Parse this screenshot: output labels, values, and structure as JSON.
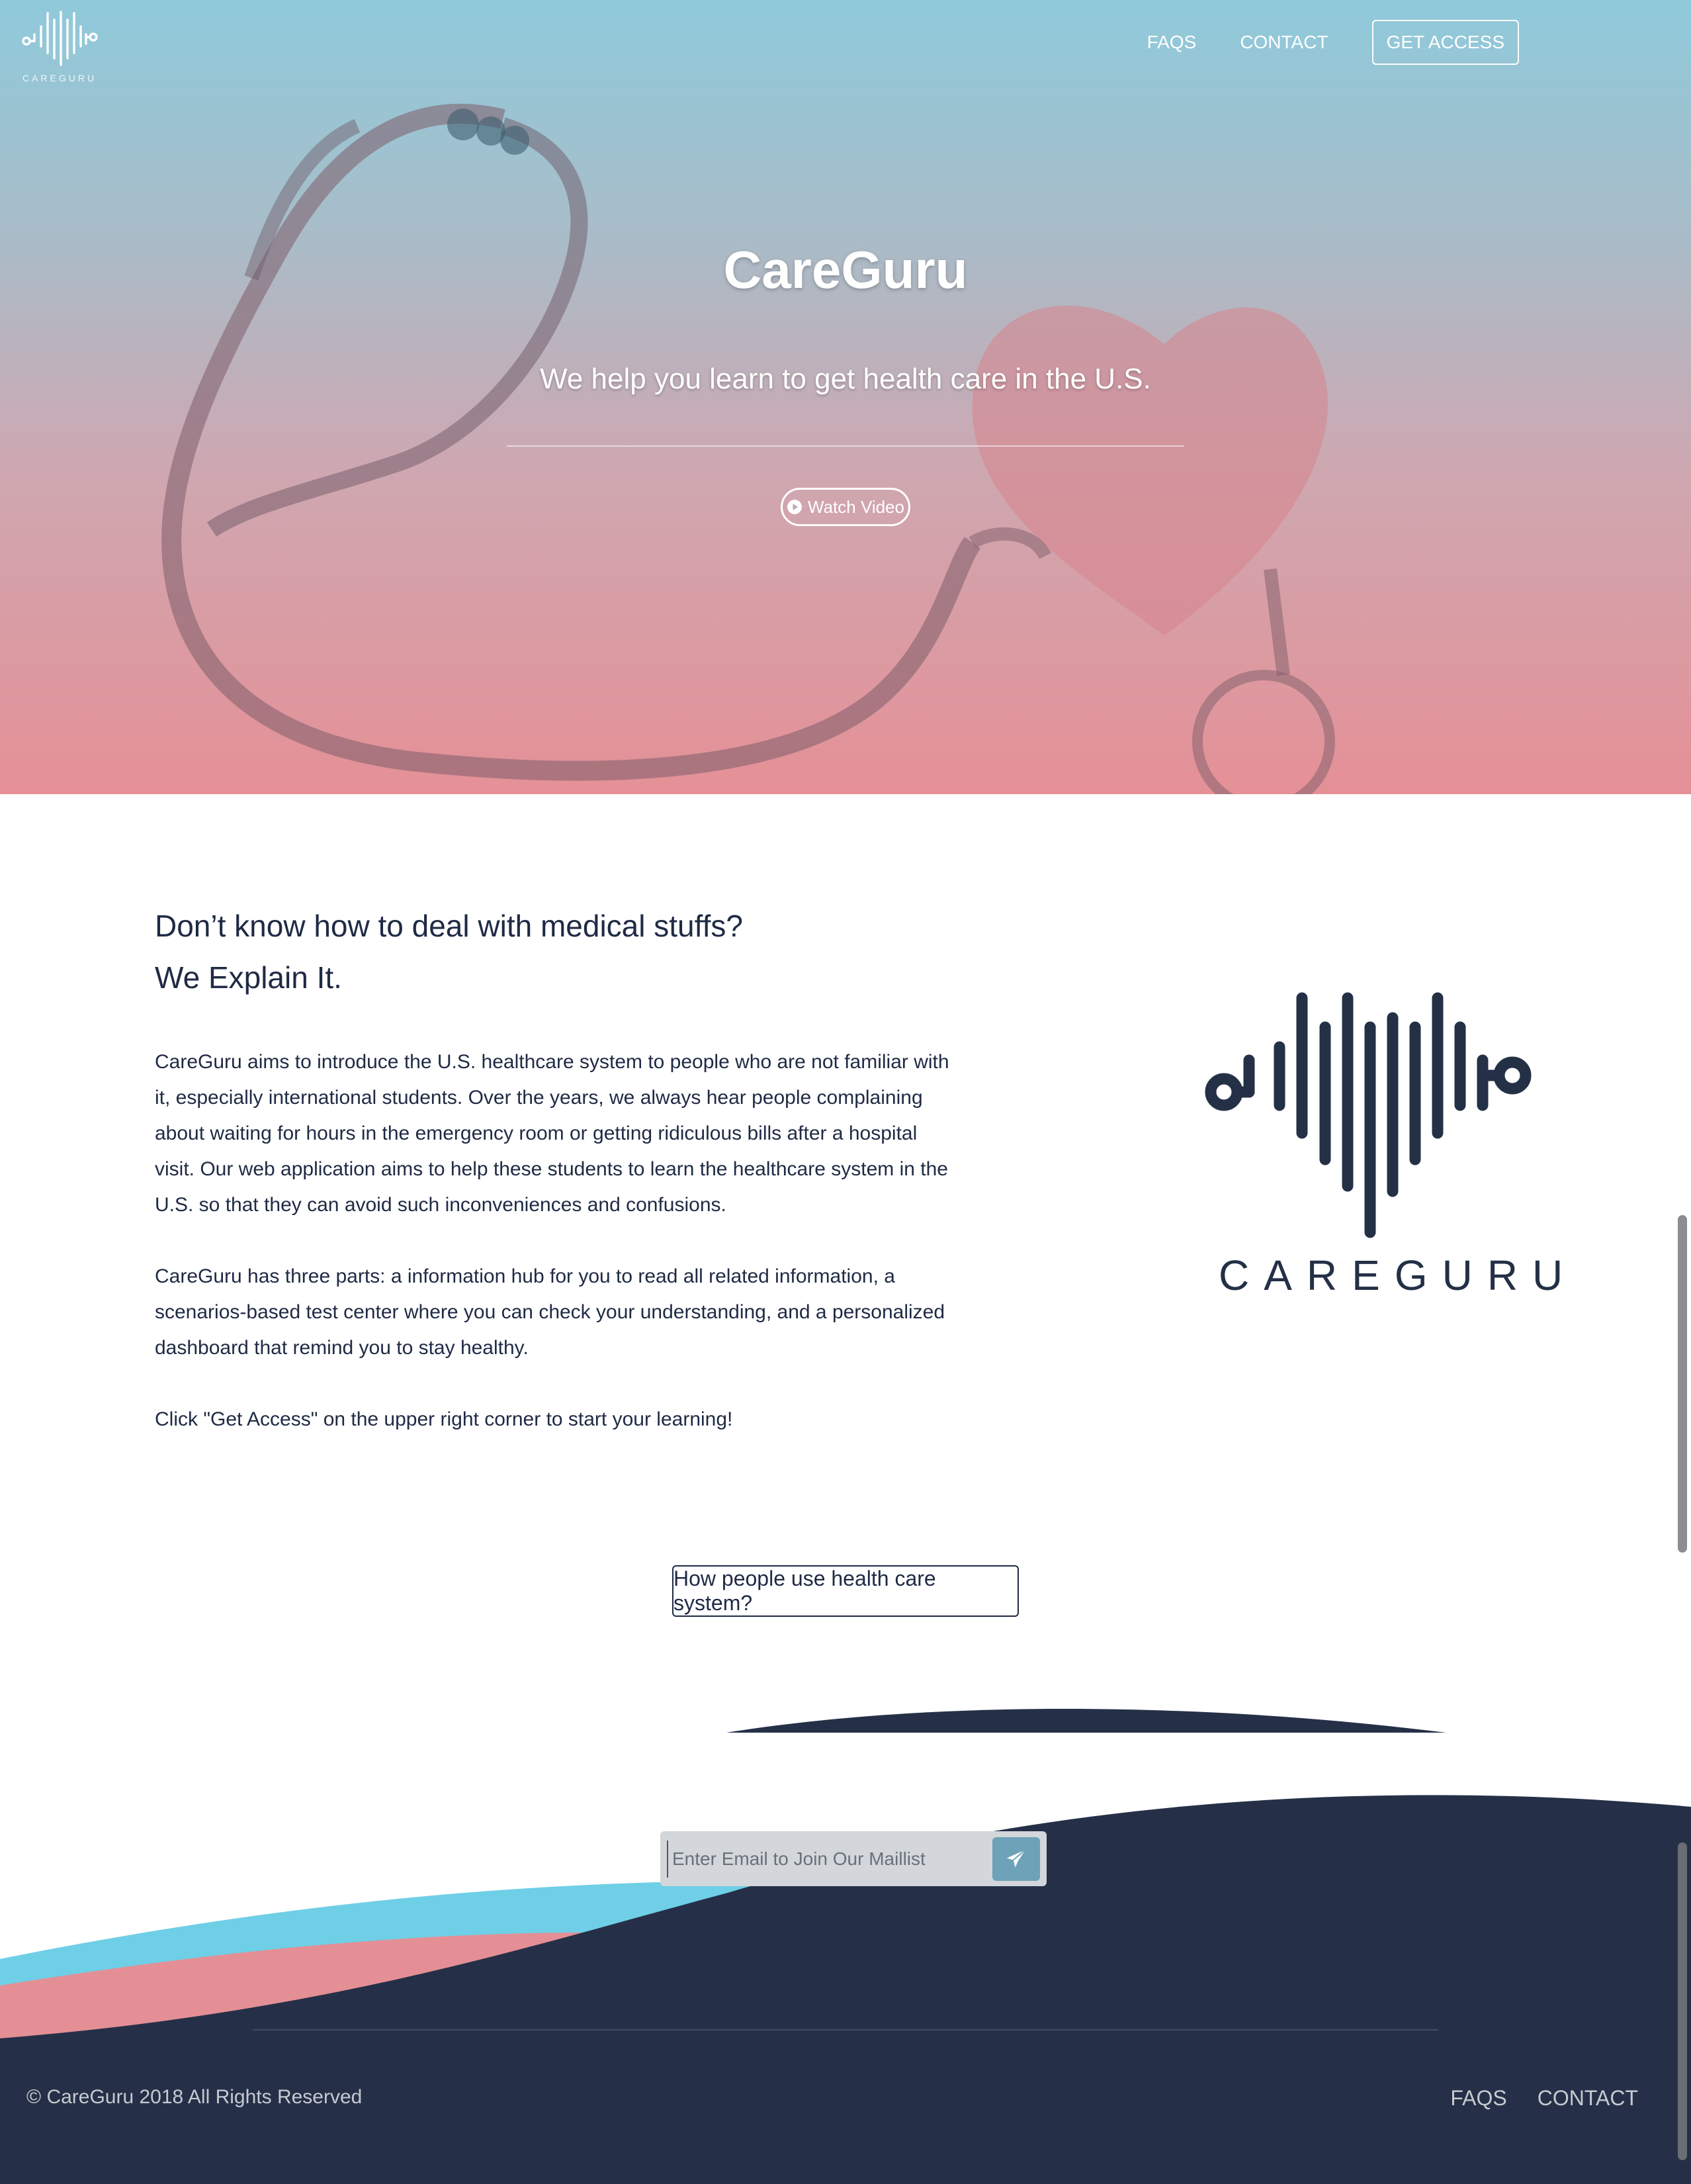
{
  "brand": {
    "name": "CareGuru",
    "logo_text": "CAREGURU"
  },
  "nav": {
    "faqs": "FAQS",
    "contact": "CONTACT",
    "get_access": "GET ACCESS"
  },
  "hero": {
    "title": "CareGuru",
    "subtitle": "We help you learn to get health care in the U.S.",
    "watch_label": "Watch Video"
  },
  "about": {
    "headline_line1": "Don’t know how to deal with medical stuffs?",
    "headline_line2": "We Explain It.",
    "paragraph1": "CareGuru aims to introduce the U.S. healthcare system to people who are not familiar with it, especially international students. Over the years, we always hear people complaining about waiting for hours in the emergency room or getting ridiculous bills after a hospital visit. Our web application aims to help these students to learn the healthcare system in the U.S. so that they can avoid such inconveniences and confusions.",
    "paragraph2": "CareGuru has three parts: a information hub for you to read all related information, a scenarios-based test center where you can check your understanding, and a personalized dashboard that remind you to stay healthy.",
    "paragraph3": "Click \"Get Access\" on the upper right corner to start your learning!"
  },
  "cta": {
    "how_label": "How people use health care system?"
  },
  "subscribe": {
    "placeholder": "Enter Email to Join Our Maillist"
  },
  "footer": {
    "copyright": "© CareGuru 2018 All Rights Reserved",
    "faqs": "FAQS",
    "contact": "CONTACT"
  },
  "colors": {
    "navy": "#253048",
    "cyan": "#6fcfe6",
    "pink": "#e48f95",
    "send_button": "#6da2b8",
    "hero_top": "#8fcadb",
    "hero_bottom": "#e59096"
  },
  "icons": {
    "watch": "play-circle-icon",
    "send": "paper-plane-icon"
  }
}
